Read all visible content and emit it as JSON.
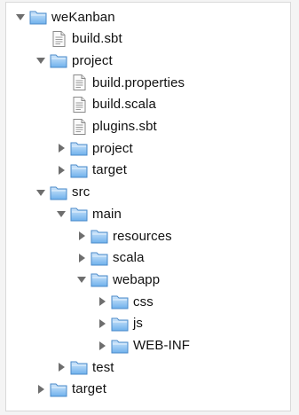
{
  "tree": [
    {
      "label": "weKanban",
      "type": "folder",
      "state": "open",
      "depth": 0
    },
    {
      "label": "build.sbt",
      "type": "file",
      "depth": 1
    },
    {
      "label": "project",
      "type": "folder",
      "state": "open",
      "depth": 1
    },
    {
      "label": "build.properties",
      "type": "file",
      "depth": 2
    },
    {
      "label": "build.scala",
      "type": "file",
      "depth": 2
    },
    {
      "label": "plugins.sbt",
      "type": "file",
      "depth": 2
    },
    {
      "label": "project",
      "type": "folder",
      "state": "closed",
      "depth": 2
    },
    {
      "label": "target",
      "type": "folder",
      "state": "closed",
      "depth": 2
    },
    {
      "label": "src",
      "type": "folder",
      "state": "open",
      "depth": 1
    },
    {
      "label": "main",
      "type": "folder",
      "state": "open",
      "depth": 2
    },
    {
      "label": "resources",
      "type": "folder",
      "state": "closed",
      "depth": 3
    },
    {
      "label": "scala",
      "type": "folder",
      "state": "closed",
      "depth": 3
    },
    {
      "label": "webapp",
      "type": "folder",
      "state": "open",
      "depth": 3
    },
    {
      "label": "css",
      "type": "folder",
      "state": "closed",
      "depth": 4
    },
    {
      "label": "js",
      "type": "folder",
      "state": "closed",
      "depth": 4
    },
    {
      "label": "WEB-INF",
      "type": "folder",
      "state": "closed",
      "depth": 4
    },
    {
      "label": "test",
      "type": "folder",
      "state": "closed",
      "depth": 2
    },
    {
      "label": "target",
      "type": "folder",
      "state": "closed",
      "depth": 1
    }
  ],
  "colors": {
    "folder_light": "#cfe6fb",
    "folder_dark": "#6fb1ec",
    "folder_stroke": "#4a8ac9",
    "triangle": "#6e6e6e"
  },
  "icons": {
    "folder": "folder-icon",
    "file": "file-icon",
    "expanded": "disclosure-triangle-open-icon",
    "collapsed": "disclosure-triangle-closed-icon"
  }
}
